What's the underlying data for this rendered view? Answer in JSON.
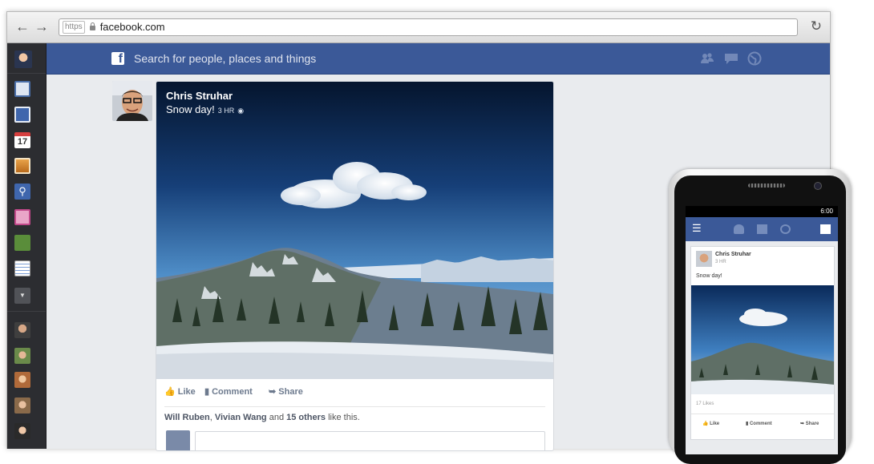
{
  "browser": {
    "back_icon": "back-arrow-icon",
    "forward_icon": "forward-arrow-icon",
    "scheme": "https",
    "url": "facebook.com",
    "reload_icon": "reload-icon"
  },
  "topbar": {
    "logo_letter": "f",
    "search_placeholder": "Search for people, places and things",
    "icons": [
      "friend-requests-icon",
      "messages-icon",
      "notifications-globe-icon"
    ]
  },
  "leftbar": {
    "calendar_day": "17",
    "items": [
      "profile-avatar",
      "news-feed-icon",
      "messages-icon",
      "events-calendar-icon",
      "photos-icon",
      "search-icon",
      "gifts-icon",
      "game-icon",
      "notes-icon",
      "more-chevron-icon"
    ],
    "friends": [
      "friend-avatar-1",
      "friend-avatar-2",
      "friend-avatar-3",
      "friend-avatar-4",
      "friend-avatar-5"
    ]
  },
  "post": {
    "author": "Chris Struhar",
    "text": "Snow day!",
    "time": "3 HR",
    "actions": {
      "like": "Like",
      "comment": "Comment",
      "share": "Share"
    },
    "likes": {
      "name1": "Will Ruben",
      "sep": ", ",
      "name2": "Vivian Wang",
      "and": " and ",
      "others": "15 others",
      "suffix": " like this."
    }
  },
  "phone": {
    "clock": "6:00",
    "post": {
      "author": "Chris Struhar",
      "time": "3 HR",
      "text": "Snow day!",
      "likes_count": "17 Likes",
      "actions": {
        "like": "Like",
        "comment": "Comment",
        "share": "Share"
      }
    }
  },
  "colors": {
    "brand": "#3b5998",
    "leftbar": "#2c2d31",
    "page_bg": "#e9ebee"
  }
}
